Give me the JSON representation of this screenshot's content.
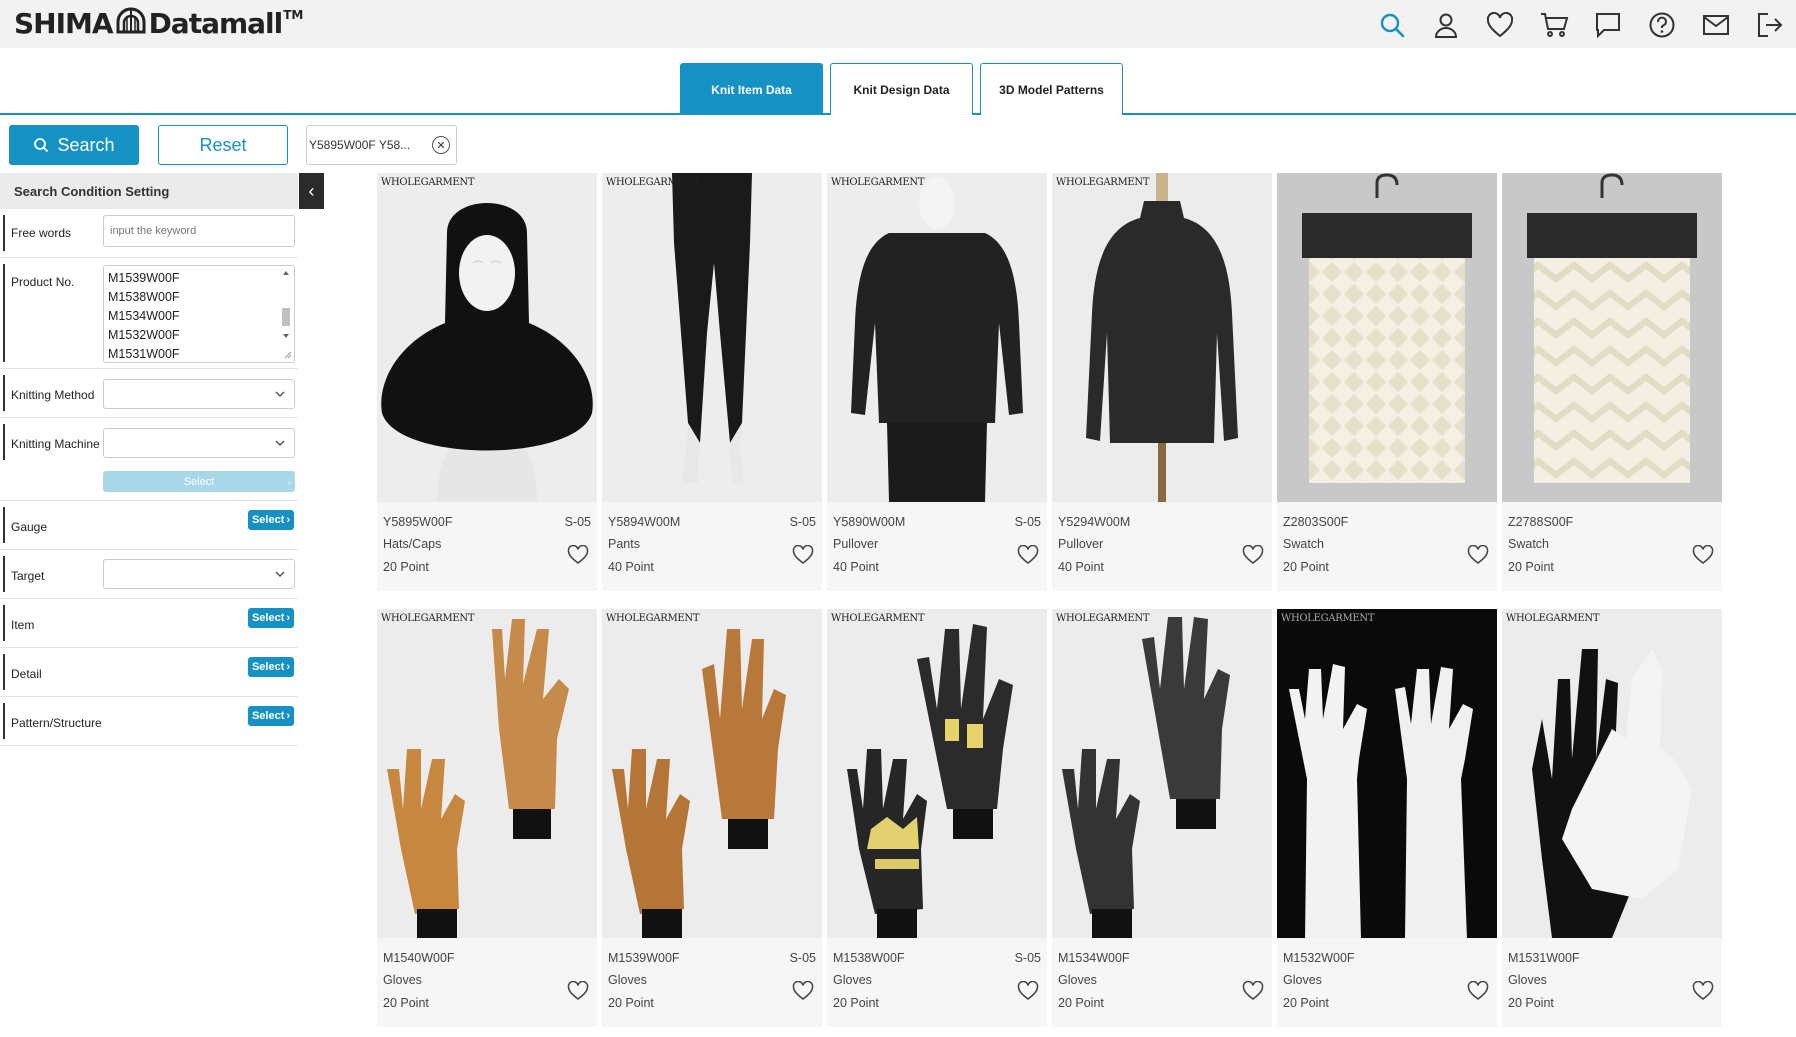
{
  "brand": {
    "name_left": "SHIMA",
    "name_right": "Datamall",
    "tm": "TM"
  },
  "header_icons": [
    "search-icon",
    "user-icon",
    "heart-icon",
    "cart-icon",
    "chat-icon",
    "help-icon",
    "mail-icon",
    "logout-icon"
  ],
  "accent_color": "#1591c4",
  "tabs": [
    {
      "label": "Knit Item Data",
      "active": true
    },
    {
      "label": "Knit Design Data",
      "active": false
    },
    {
      "label": "3D Model Patterns",
      "active": false
    }
  ],
  "toolbar": {
    "search_label": "Search",
    "reset_label": "Reset",
    "chip_label": "Y5895W00F Y58..."
  },
  "sidebar": {
    "title": "Search Condition Setting",
    "free_words_label": "Free words",
    "free_words_placeholder": "input the keyword",
    "product_no_label": "Product No.",
    "product_no_options": [
      "M1539W00F",
      "M1538W00F",
      "M1534W00F",
      "M1532W00F",
      "M1531W00F"
    ],
    "knitting_method_label": "Knitting Method",
    "knitting_machine_label": "Knitting Machine",
    "machine_select_label": "Select",
    "gauge_label": "Gauge",
    "target_label": "Target",
    "item_label": "Item",
    "detail_label": "Detail",
    "pattern_label": "Pattern/Structure",
    "select_label": "Select"
  },
  "products": [
    {
      "pno": "Y5895W00F",
      "code": "S-05",
      "category": "Hats/Caps",
      "gauge": "20 Point",
      "wg": "WHOLEGARMENT"
    },
    {
      "pno": "Y5894W00M",
      "code": "S-05",
      "category": "Pants",
      "gauge": "40 Point",
      "wg": "WHOLEGARMENT"
    },
    {
      "pno": "Y5890W00M",
      "code": "S-05",
      "category": "Pullover",
      "gauge": "40 Point",
      "wg": "WHOLEGARMENT"
    },
    {
      "pno": "Y5294W00M",
      "code": "",
      "category": "Pullover",
      "gauge": "40 Point",
      "wg": "WHOLEGARMENT"
    },
    {
      "pno": "Z2803S00F",
      "code": "",
      "category": "Swatch",
      "gauge": "20 Point",
      "wg": ""
    },
    {
      "pno": "Z2788S00F",
      "code": "",
      "category": "Swatch",
      "gauge": "20 Point",
      "wg": ""
    },
    {
      "pno": "M1540W00F",
      "code": "",
      "category": "Gloves",
      "gauge": "20 Point",
      "wg": "WHOLEGARMENT"
    },
    {
      "pno": "M1539W00F",
      "code": "S-05",
      "category": "Gloves",
      "gauge": "20 Point",
      "wg": "WHOLEGARMENT"
    },
    {
      "pno": "M1538W00F",
      "code": "S-05",
      "category": "Gloves",
      "gauge": "20 Point",
      "wg": "WHOLEGARMENT"
    },
    {
      "pno": "M1534W00F",
      "code": "",
      "category": "Gloves",
      "gauge": "20 Point",
      "wg": "WHOLEGARMENT"
    },
    {
      "pno": "M1532W00F",
      "code": "",
      "category": "Gloves",
      "gauge": "20 Point",
      "wg": "WHOLEGARMENT"
    },
    {
      "pno": "M1531W00F",
      "code": "",
      "category": "Gloves",
      "gauge": "20 Point",
      "wg": "WHOLEGARMENT"
    }
  ]
}
